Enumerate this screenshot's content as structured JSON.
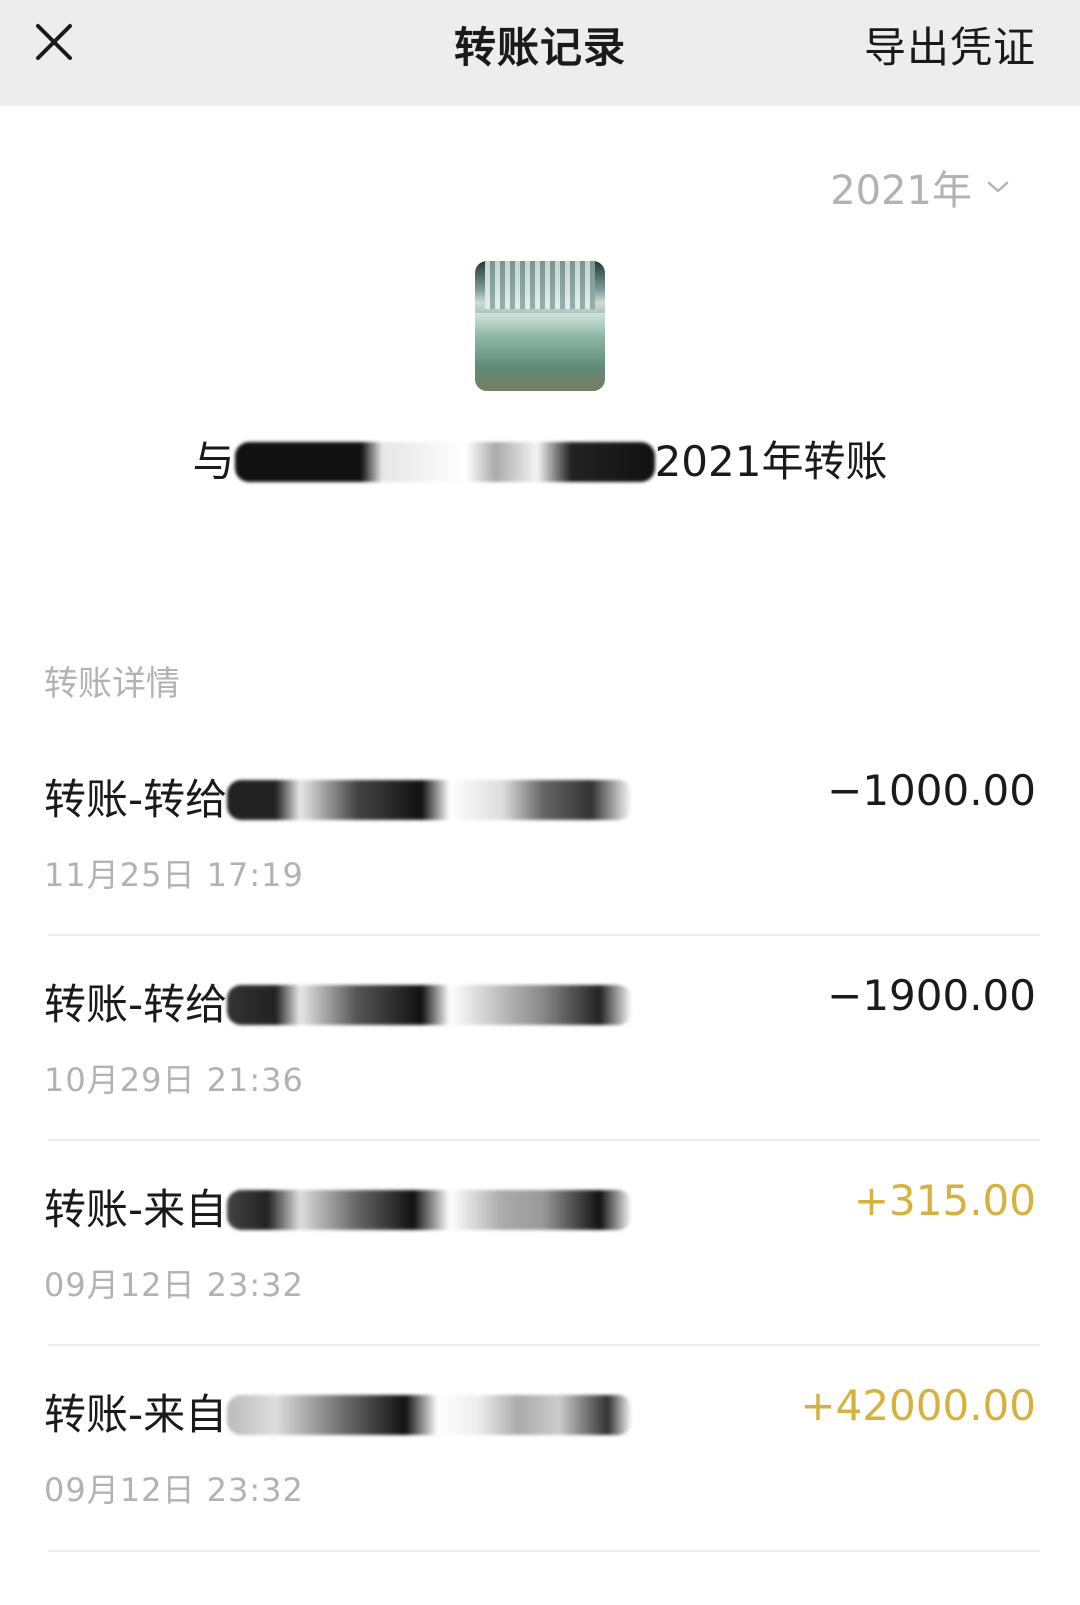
{
  "header": {
    "title": "转账记录",
    "export_label": "导出凭证",
    "close_icon": "close-icon"
  },
  "year_selector": {
    "value": "2021年",
    "icon": "chevron-down-icon"
  },
  "summary": {
    "prefix": "与",
    "suffix": "2021年转账"
  },
  "section": {
    "label": "转账详情"
  },
  "colors": {
    "expense": "#1a1a1a",
    "income": "#d6b23c",
    "muted": "#b2b2b2"
  },
  "transactions": [
    {
      "desc": "转账-转给",
      "time": "11月25日 17:19",
      "amount": "−1000.00",
      "direction": "out"
    },
    {
      "desc": "转账-转给",
      "time": "10月29日 21:36",
      "amount": "−1900.00",
      "direction": "out"
    },
    {
      "desc": "转账-来自",
      "time": "09月12日 23:32",
      "amount": "+315.00",
      "direction": "in"
    },
    {
      "desc": "转账-来自",
      "time": "09月12日 23:32",
      "amount": "+42000.00",
      "direction": "in"
    }
  ]
}
